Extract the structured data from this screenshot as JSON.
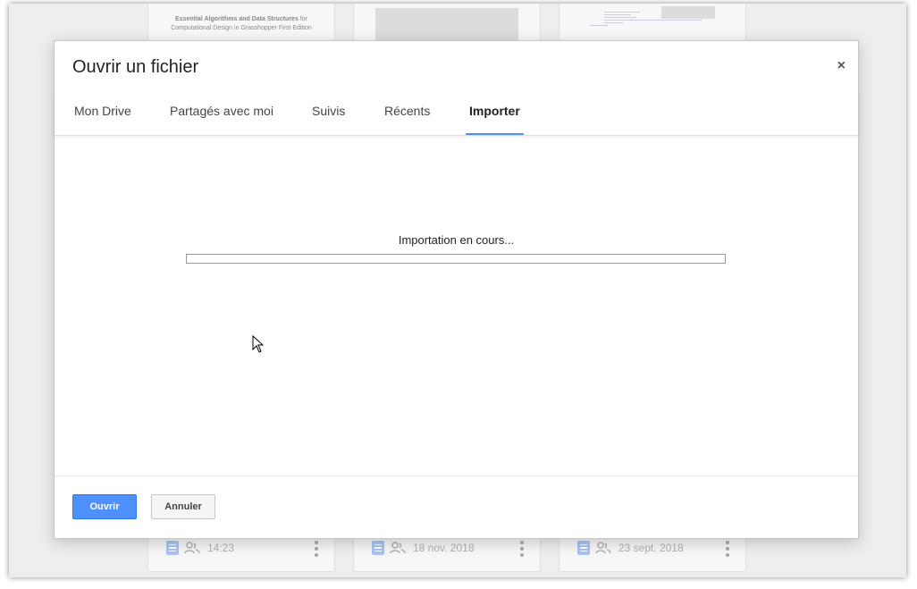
{
  "background": {
    "cards": [
      {
        "thumb_title_bold": "Essential Algorithms and Data Structures",
        "thumb_title_rest": "for Computational Design in Grasshopper First Edition",
        "timestamp": "14:23"
      },
      {
        "timestamp": "18 nov. 2018"
      },
      {
        "timestamp": "23 sept. 2018"
      }
    ]
  },
  "dialog": {
    "title": "Ouvrir un fichier",
    "close_label": "×",
    "tabs": [
      {
        "label": "Mon Drive"
      },
      {
        "label": "Partagés avec moi"
      },
      {
        "label": "Suivis"
      },
      {
        "label": "Récents"
      },
      {
        "label": "Importer",
        "active": true
      }
    ],
    "upload": {
      "status_text": "Importation en cours...",
      "progress_fraction": 0.0
    },
    "footer": {
      "open_label": "Ouvrir",
      "cancel_label": "Annuler"
    }
  },
  "colors": {
    "accent": "#4d90fe",
    "doc_icon": "#a9c4f5"
  }
}
